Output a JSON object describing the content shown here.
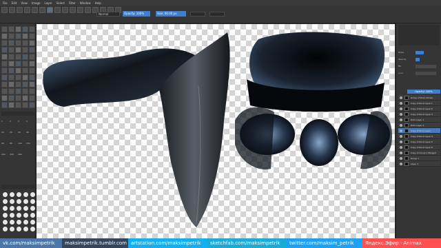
{
  "menu": [
    "File",
    "Edit",
    "View",
    "Image",
    "Layer",
    "Select",
    "Filter",
    "Window",
    "Help"
  ],
  "toolbar": {
    "blend_mode": "Normal",
    "field_1": "Opacity: 100%",
    "field_2": "Size: 60.00 px"
  },
  "brush_sizes": [
    "1",
    "2",
    "3",
    "5",
    "10",
    "20",
    "30",
    "40",
    "60",
    "80",
    "100",
    "150",
    "200",
    "300",
    "400"
  ],
  "right_panel": {
    "tab_active": "Opacity: 100%",
    "field_labels": [
      "Mode",
      "Opacity",
      "Fill",
      "Lock"
    ],
    "layers": [
      {
        "name": "Group of Rock stones",
        "active": false
      },
      {
        "name": "Copy of Rock Layer 1",
        "active": false
      },
      {
        "name": "Copy of Rock Layer 2",
        "active": false
      },
      {
        "name": "Copy of Rock Layer 3",
        "active": false
      },
      {
        "name": "Rock Layer 1",
        "active": false
      },
      {
        "name": "Rock Layer 2",
        "active": false
      },
      {
        "name": "Copy of Rock Layer",
        "active": true
      },
      {
        "name": "Copy of Rock Layer 4",
        "active": false
      },
      {
        "name": "Copy of Rock Layer 5",
        "active": false
      },
      {
        "name": "Copy of Rock Layer 6",
        "active": false
      },
      {
        "name": "Copy of Group 1 Merged",
        "active": false
      },
      {
        "name": "Group 1",
        "active": false
      },
      {
        "name": "Layer 1",
        "active": false
      }
    ]
  },
  "links": [
    {
      "text": "vk.com/maksimpetrik",
      "bg": "#4a76a8"
    },
    {
      "text": "maksimpetrik.tumblr.com",
      "bg": "#35465c"
    },
    {
      "text": "artstation.com/maksimpetrik",
      "bg": "#13aff0"
    },
    {
      "text": "sketchfab.com/maksimpetrik",
      "bg": "#1caad9"
    },
    {
      "text": "twitter.com/maksim_petrik",
      "bg": "#1da1f2"
    },
    {
      "text": "Яндекс.Эфир · Animax",
      "bg": "#ff4f4f"
    }
  ]
}
